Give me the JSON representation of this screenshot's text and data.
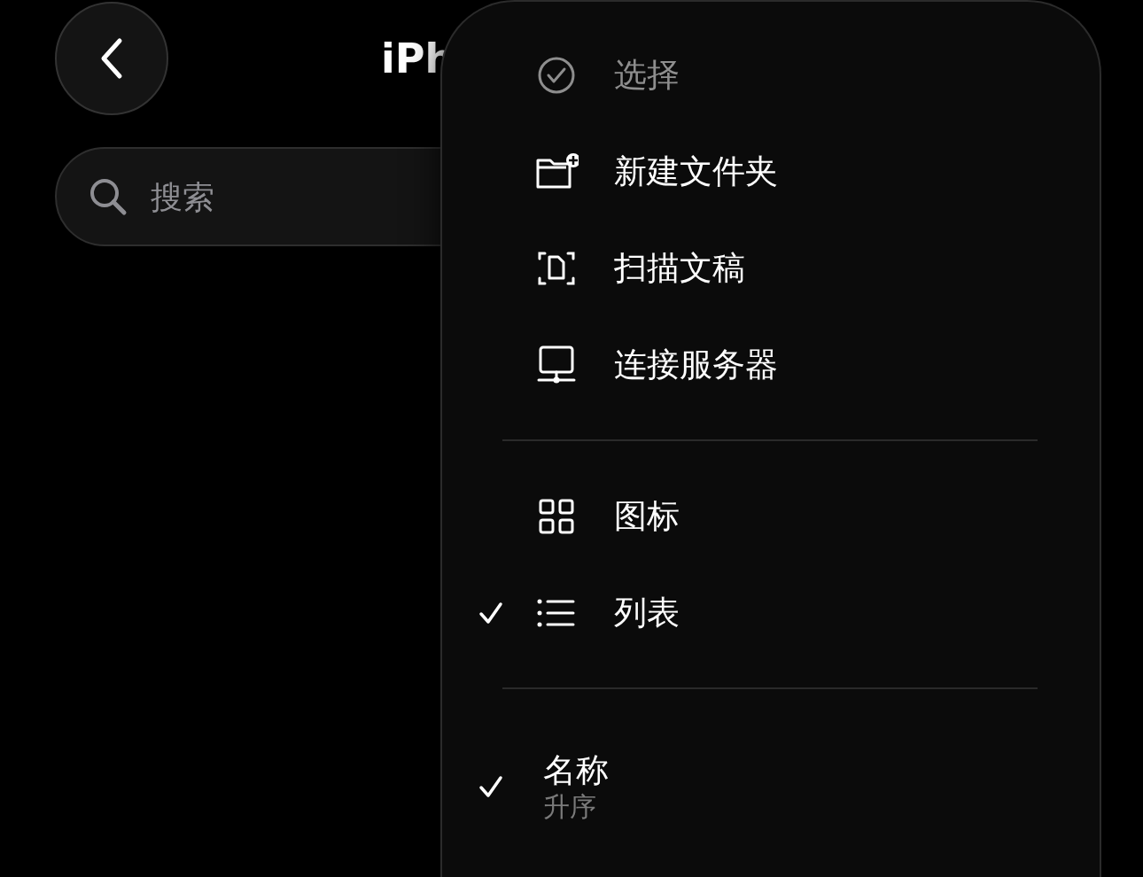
{
  "header": {
    "title": "iPh"
  },
  "search": {
    "placeholder": "搜索"
  },
  "menu": {
    "sections": [
      {
        "items": [
          {
            "label": "选择",
            "disabled": true,
            "checked": false
          },
          {
            "label": "新建文件夹",
            "disabled": false,
            "checked": false
          },
          {
            "label": "扫描文稿",
            "disabled": false,
            "checked": false
          },
          {
            "label": "连接服务器",
            "disabled": false,
            "checked": false
          }
        ]
      },
      {
        "items": [
          {
            "label": "图标",
            "disabled": false,
            "checked": false
          },
          {
            "label": "列表",
            "disabled": false,
            "checked": true
          }
        ]
      },
      {
        "items": [
          {
            "label": "名称",
            "subtitle": "升序",
            "disabled": false,
            "checked": true
          }
        ]
      }
    ]
  }
}
